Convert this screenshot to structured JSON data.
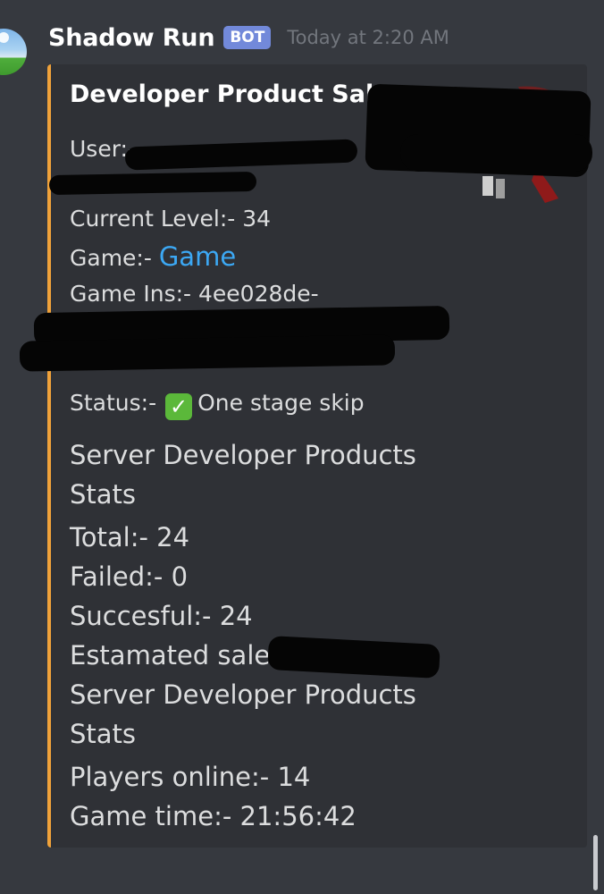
{
  "author": {
    "name": "Shadow Run",
    "tag": "BOT",
    "timestamp": "Today at 2:20 AM"
  },
  "embed": {
    "accent_color": "#f0a23a",
    "title": "Developer Product Sale",
    "user_label": "User:-",
    "current_level": "Current Level:- 34",
    "game_label": "Game:-",
    "game_link": "Game",
    "game_ins": "Game Ins:- 4ee028de-",
    "status_label": "Status:-",
    "status_value": "One stage skip",
    "status_icon": "white-check-mark-icon",
    "stats_heading_1": "Server Developer Products",
    "stats_heading_1b": "Stats",
    "total": "Total:- 24",
    "failed": "Failed:- 0",
    "succesful": "Succesful:- 24",
    "estimated_sales": "Estamated sales:",
    "stats_heading_2": "Server Developer Products",
    "stats_heading_2b": "Stats",
    "players_online": "Players online:- 14",
    "game_time": "Game time:- 21:56:42"
  },
  "colors": {
    "background": "#36393f",
    "embed_bg": "#2f3136",
    "link": "#3ca8f4",
    "bot_tag": "#7289da"
  }
}
